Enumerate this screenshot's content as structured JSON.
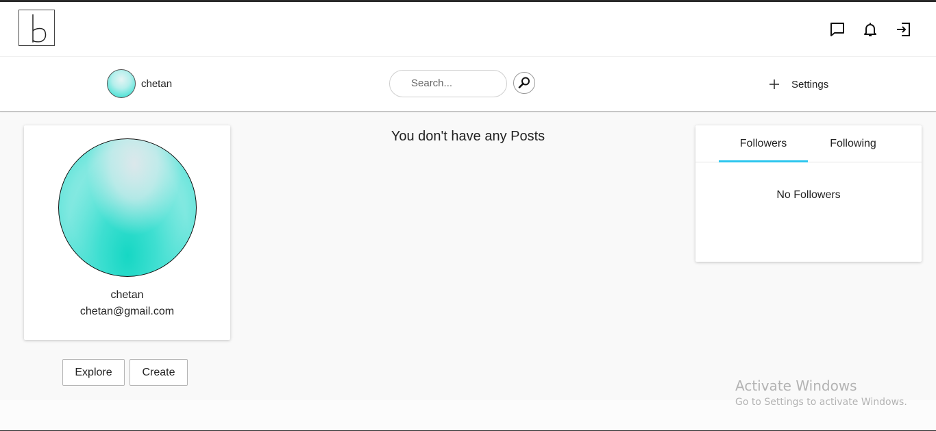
{
  "header": {
    "logo_icon": "b-logo-icon",
    "icons": [
      "chat-icon",
      "bell-icon",
      "logout-icon"
    ]
  },
  "nav": {
    "user_name": "chetan",
    "search_placeholder": "Search...",
    "search_icon": "search-icon",
    "settings_label": "Settings",
    "settings_icon": "plus-icon"
  },
  "profile": {
    "name": "chetan",
    "email": "chetan@gmail.com"
  },
  "actions": {
    "explore_label": "Explore",
    "create_label": "Create"
  },
  "posts": {
    "empty_message": "You don't have any Posts"
  },
  "follow": {
    "tabs": [
      {
        "label": "Followers",
        "active": true
      },
      {
        "label": "Following",
        "active": false
      }
    ],
    "empty_message": "No Followers"
  },
  "watermark": {
    "title": "Activate Windows",
    "subtitle": "Go to Settings to activate Windows."
  },
  "colors": {
    "accent_tab": "#2cc6ee",
    "avatar_teal": "#1fd6c6"
  }
}
